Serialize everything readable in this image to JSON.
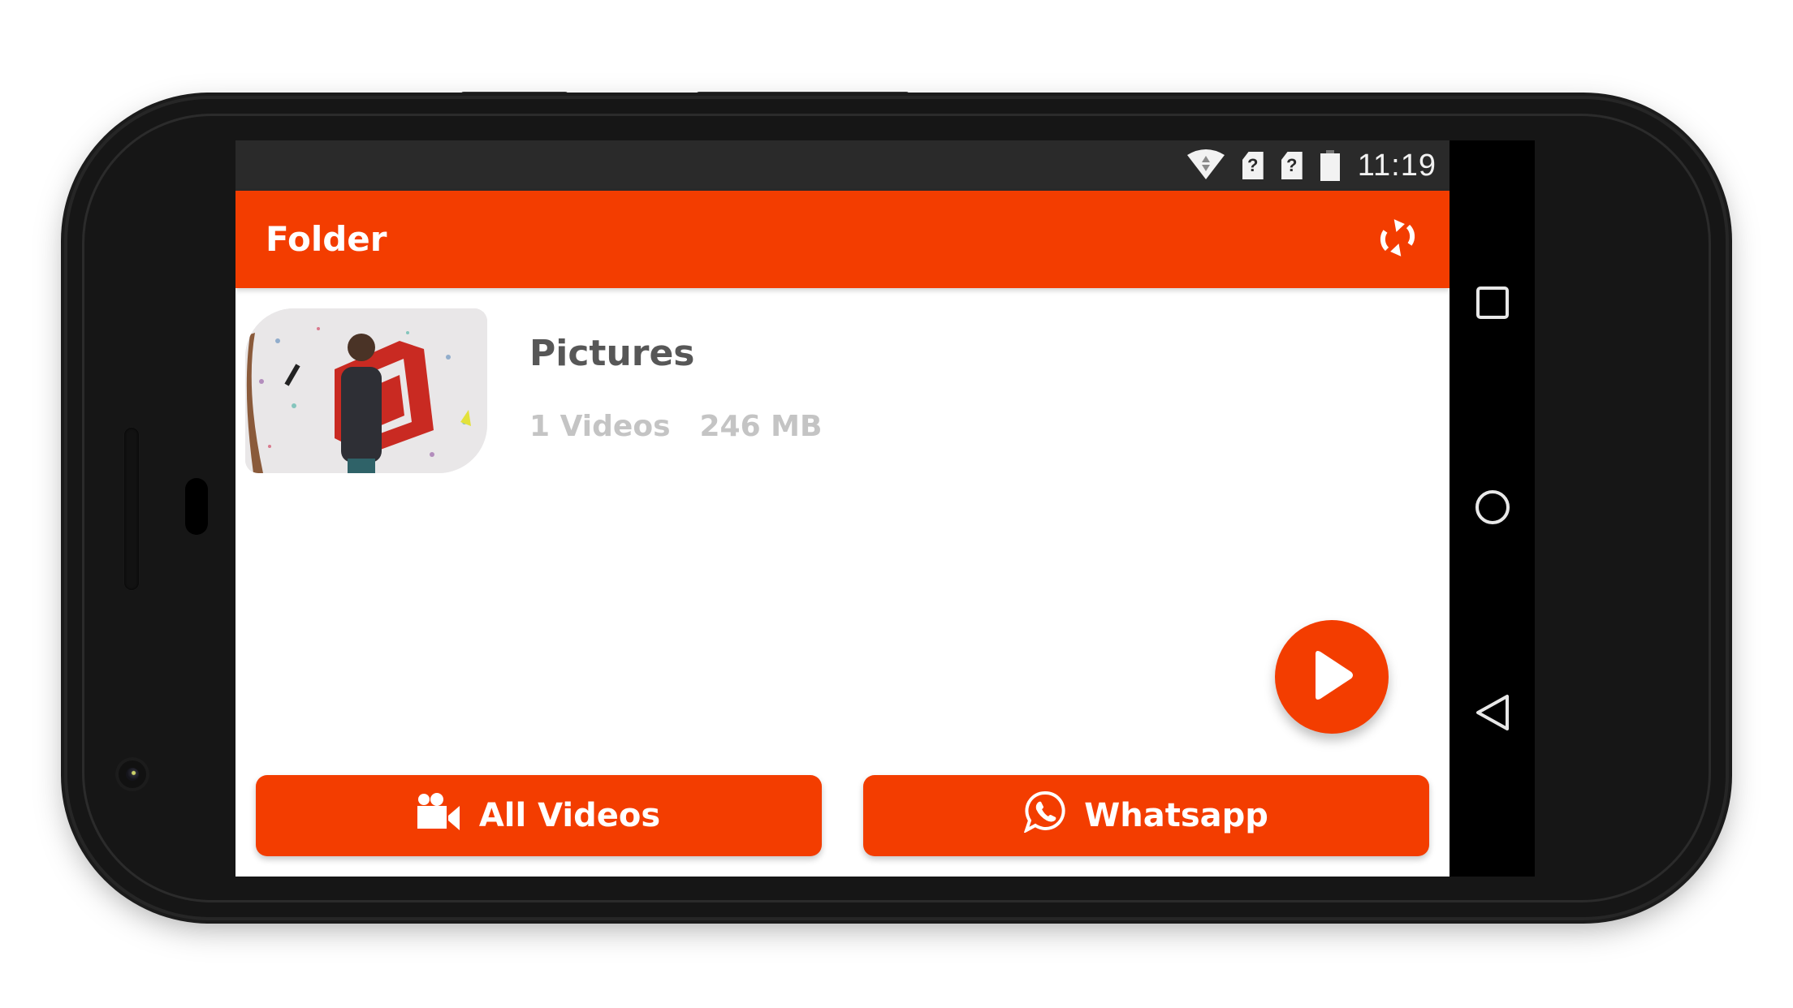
{
  "status_bar": {
    "time": "11:19",
    "icons": [
      "wifi-icon",
      "sim-unknown-icon",
      "sim-unknown-icon",
      "battery-icon"
    ],
    "sim_glyph": "?"
  },
  "app_bar": {
    "title": "Folder",
    "action_icon": "refresh-icon"
  },
  "folders": [
    {
      "name": "Pictures",
      "count": "1 Videos",
      "size": "246 MB",
      "thumbnail": "video-thumbnail"
    }
  ],
  "fab": {
    "icon": "play-icon"
  },
  "buttons": {
    "all_videos": {
      "label": "All Videos",
      "icon": "video-camera-icon"
    },
    "whatsapp": {
      "label": "Whatsapp",
      "icon": "whatsapp-icon"
    }
  },
  "nav": {
    "recents": "recents-icon",
    "home": "home-icon",
    "back": "back-icon"
  },
  "colors": {
    "accent": "#f33d00",
    "status_bar": "#2a2a2a",
    "title_text": "#575757",
    "meta_text": "#c4c4c4"
  }
}
